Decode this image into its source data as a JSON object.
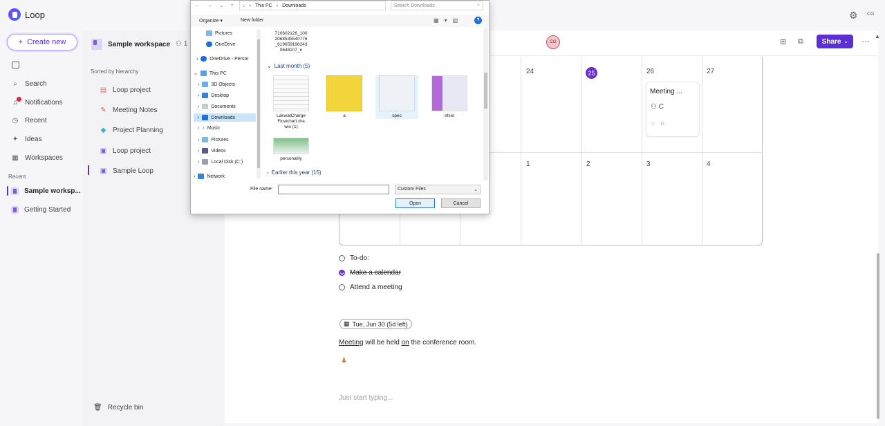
{
  "app": {
    "name": "Loop",
    "user_initials": "CG"
  },
  "nav": {
    "create_label": "Create new",
    "items": [
      {
        "label": "Search",
        "icon": "search-icon"
      },
      {
        "label": "Notifications",
        "icon": "bell-icon"
      },
      {
        "label": "Recent",
        "icon": "clock-icon"
      },
      {
        "label": "Ideas",
        "icon": "lightbulb-icon"
      },
      {
        "label": "Workspaces",
        "icon": "grid-icon"
      }
    ],
    "recent_label": "Recent",
    "recent": [
      {
        "label": "Sample worksp..."
      },
      {
        "label": "Getting Started"
      }
    ]
  },
  "workspace": {
    "title": "Sample workspace",
    "members": "1",
    "sorted_label": "Sorted by hierarchy",
    "pages": [
      {
        "label": "Loop project"
      },
      {
        "label": "Meeting Notes"
      },
      {
        "label": "Project Planning"
      },
      {
        "label": "Loop project"
      },
      {
        "label": "Sample Loop"
      }
    ],
    "recycle_label": "Recycle bin"
  },
  "toolbar": {
    "collab_initials": "CG",
    "share_label": "Share",
    "more_label": "···"
  },
  "calendar": {
    "row1": [
      "24",
      "25",
      "26",
      "27"
    ],
    "row2": [
      "1",
      "2",
      "3",
      "4"
    ],
    "event": {
      "title": "Meeting ...",
      "person": "C"
    }
  },
  "tasks": [
    {
      "label": "To-do:",
      "done": false
    },
    {
      "label": "Make a calendar",
      "done": true
    },
    {
      "label": "Attend a meeting",
      "done": false
    }
  ],
  "date_chip": "Tue, Jun 30 (5d left)",
  "meeting_text": {
    "w1": "Meeting",
    "w2": " will be held ",
    "w3": "on",
    "w4": " the conference room."
  },
  "placeholder": "Just start typing...",
  "dialog": {
    "breadcrumb": [
      "This PC",
      "Downloads"
    ],
    "search_placeholder": "Search Downloads",
    "organize_label": "Organize",
    "newfolder_label": "New folder",
    "tree": [
      "Pictures",
      "OneDrive",
      "OneDrive - Persor",
      "This PC",
      "3D Objects",
      "Desktop",
      "Documents",
      "Downloads",
      "Music",
      "Pictures",
      "Videos",
      "Local Disk (C:)",
      "Network"
    ],
    "top_file": "710602126_100\n2068535540776\n_619659198243\n0648107_n",
    "group_last_month": "Last month (5)",
    "files": [
      {
        "name": "LakwatCharge\nFlowchart.dra\nwio (1)"
      },
      {
        "name": "a"
      },
      {
        "name": "spec"
      },
      {
        "name": "efset"
      },
      {
        "name": "personality"
      }
    ],
    "group_earlier": "Earlier this year (15)",
    "filename_label": "File name:",
    "filename_value": "",
    "filetype": "Custom Files",
    "open_label": "Open",
    "cancel_label": "Cancel"
  },
  "colors": {
    "accent": "#5b2ed6",
    "today": "#6a2ed6",
    "notification": "#c4314b"
  }
}
